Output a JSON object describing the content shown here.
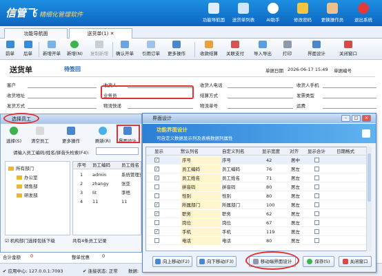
{
  "app": {
    "logo": "信管飞",
    "tagline": "精细化管理软件",
    "top_buttons": [
      {
        "label": "功能导航面",
        "icon": "monitor-icon"
      },
      {
        "label": "送货单列表",
        "icon": "list-icon"
      },
      {
        "label": "AI助手",
        "icon": "info-icon"
      },
      {
        "label": "修改密码",
        "icon": "lock-icon"
      },
      {
        "label": "更换操作员",
        "icon": "user-icon"
      },
      {
        "label": "退出系统",
        "icon": "exit-icon"
      }
    ]
  },
  "tabs": [
    {
      "label": "功能导航面"
    },
    {
      "label": "送货单(1)"
    }
  ],
  "toolbar": [
    {
      "label": "前单"
    },
    {
      "label": "后单"
    },
    {
      "label": "新增开单"
    },
    {
      "label": "新增(N)"
    },
    {
      "label": "复制新增"
    },
    {
      "label": "确认开单"
    },
    {
      "label": "引用订单"
    },
    {
      "label": "更多操作"
    },
    {
      "label": "收款结算"
    },
    {
      "label": "关联支付"
    },
    {
      "label": "导入导出"
    },
    {
      "label": "打印"
    },
    {
      "label": "界面设计"
    },
    {
      "label": "关闭窗口"
    }
  ],
  "order": {
    "title": "送货单",
    "status": "待签回",
    "date_label": "单据日期",
    "date_value": "2026-06-17 15:49",
    "number_label": "单据编号",
    "fields": [
      "客户",
      "收货人",
      "收货人电话",
      "收货人手机",
      "收货地址",
      "业务员",
      "结算方式",
      "发票类型",
      "发货方式",
      "物流快递",
      "物流单号",
      "运费"
    ]
  },
  "employee_window": {
    "title": "选择员工",
    "buttons": [
      {
        "label": "选择(S)"
      },
      {
        "label": "清空员工"
      },
      {
        "label": "更多操作"
      },
      {
        "label": "刷新(R)"
      },
      {
        "label": "界面设计"
      }
    ],
    "search_label": "请输入员工编码/姓名/拼音头检索(F4):",
    "tree": [
      {
        "label": "所有部门"
      },
      {
        "label": "办公室"
      },
      {
        "label": "销售部"
      },
      {
        "label": "研发部"
      }
    ],
    "columns": [
      "序号",
      "员工编码",
      "员工姓名"
    ],
    "rows": [
      [
        "1",
        "admin",
        "系统管理员"
      ],
      [
        "2",
        "zhangy",
        "张亚"
      ],
      [
        "3",
        "lit",
        "李梧"
      ],
      [
        "4",
        "11",
        "11"
      ]
    ],
    "checkbox_label": "机构部门选择包括下级",
    "count_text": "共有4条员工记录"
  },
  "bottom": {
    "total_label": "合计金额",
    "total_value": "0",
    "discount_label": "整单优惠",
    "discount_value": "0"
  },
  "status_bar": {
    "server": "应用中心: 127.0.0.1:7093",
    "connection": "连接状态: 正常",
    "extra": "数据:"
  },
  "dialog": {
    "title": "界面设计",
    "header_title": "功能界面设计",
    "header_sub": "可自定义数据显示列及表格数据列属性",
    "columns": [
      "显示",
      "默认列名",
      "自定义列名",
      "显示宽度",
      "对齐",
      "显示合计",
      "日期格式"
    ],
    "rows": [
      {
        "show": true,
        "default": "序号",
        "custom": "序号",
        "width": "42",
        "align": "居中",
        "sum": false
      },
      {
        "show": true,
        "default": "员工编码",
        "custom": "员工编码",
        "width": "76",
        "align": "居左",
        "sum": false
      },
      {
        "show": true,
        "default": "员工姓名",
        "custom": "员工姓名",
        "width": "71",
        "align": "居左",
        "sum": false
      },
      {
        "show": false,
        "default": "拼音码",
        "custom": "拼音码",
        "width": "80",
        "align": "居左",
        "sum": false
      },
      {
        "show": false,
        "default": "性别",
        "custom": "性别",
        "width": "80",
        "align": "居左",
        "sum": false
      },
      {
        "show": true,
        "default": "所属部门",
        "custom": "所属部门",
        "width": "100",
        "align": "居左",
        "sum": false
      },
      {
        "show": true,
        "default": "职务",
        "custom": "职务",
        "width": "62",
        "align": "居左",
        "sum": false
      },
      {
        "show": false,
        "default": "岗位",
        "custom": "岗位",
        "width": "67",
        "align": "居左",
        "sum": false
      },
      {
        "show": true,
        "default": "手机",
        "custom": "手机",
        "width": "119",
        "align": "居左",
        "sum": false
      },
      {
        "show": false,
        "default": "电话",
        "custom": "电话",
        "width": "80",
        "align": "居左",
        "sum": false
      }
    ],
    "buttons": [
      {
        "label": "向上移动(F2)"
      },
      {
        "label": "向下移动(F3)"
      },
      {
        "label": "移动端界面设计"
      },
      {
        "label": "保存(S)"
      },
      {
        "label": "关闭窗口"
      }
    ]
  },
  "colors": {
    "accent": "#1e8fe0",
    "highlight": "#e0302f",
    "grid_yellow": "#fff6cf"
  }
}
